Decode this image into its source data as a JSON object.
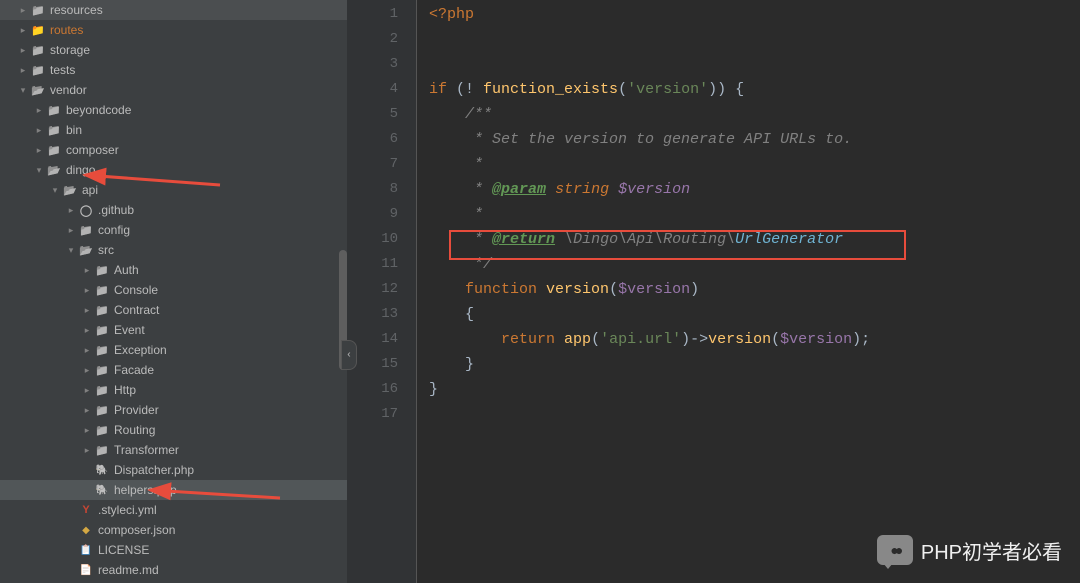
{
  "sidebar": {
    "items": [
      {
        "indent": 1,
        "chev": "closed",
        "icon": "folder",
        "label": "resources"
      },
      {
        "indent": 1,
        "chev": "closed",
        "icon": "folder-orange",
        "label": "routes",
        "orange": true
      },
      {
        "indent": 1,
        "chev": "closed",
        "icon": "folder",
        "label": "storage"
      },
      {
        "indent": 1,
        "chev": "closed",
        "icon": "folder",
        "label": "tests"
      },
      {
        "indent": 1,
        "chev": "open",
        "icon": "folder-open",
        "label": "vendor"
      },
      {
        "indent": 2,
        "chev": "closed",
        "icon": "folder",
        "label": "beyondcode"
      },
      {
        "indent": 2,
        "chev": "closed",
        "icon": "folder",
        "label": "bin"
      },
      {
        "indent": 2,
        "chev": "closed",
        "icon": "folder",
        "label": "composer"
      },
      {
        "indent": 2,
        "chev": "open",
        "icon": "folder-open",
        "label": "dingo"
      },
      {
        "indent": 3,
        "chev": "open",
        "icon": "folder-open",
        "label": "api"
      },
      {
        "indent": 4,
        "chev": "closed",
        "icon": "github",
        "label": ".github"
      },
      {
        "indent": 4,
        "chev": "closed",
        "icon": "folder",
        "label": "config"
      },
      {
        "indent": 4,
        "chev": "open",
        "icon": "folder-open",
        "label": "src"
      },
      {
        "indent": 5,
        "chev": "closed",
        "icon": "folder",
        "label": "Auth"
      },
      {
        "indent": 5,
        "chev": "closed",
        "icon": "folder",
        "label": "Console"
      },
      {
        "indent": 5,
        "chev": "closed",
        "icon": "folder",
        "label": "Contract"
      },
      {
        "indent": 5,
        "chev": "closed",
        "icon": "folder",
        "label": "Event"
      },
      {
        "indent": 5,
        "chev": "closed",
        "icon": "folder",
        "label": "Exception"
      },
      {
        "indent": 5,
        "chev": "closed",
        "icon": "folder",
        "label": "Facade"
      },
      {
        "indent": 5,
        "chev": "closed",
        "icon": "folder",
        "label": "Http"
      },
      {
        "indent": 5,
        "chev": "closed",
        "icon": "folder",
        "label": "Provider"
      },
      {
        "indent": 5,
        "chev": "closed",
        "icon": "folder",
        "label": "Routing"
      },
      {
        "indent": 5,
        "chev": "closed",
        "icon": "folder",
        "label": "Transformer"
      },
      {
        "indent": 5,
        "chev": "none",
        "icon": "php",
        "label": "Dispatcher.php"
      },
      {
        "indent": 5,
        "chev": "none",
        "icon": "php",
        "label": "helpers.php",
        "selected": true
      },
      {
        "indent": 4,
        "chev": "none",
        "icon": "yml",
        "label": ".styleci.yml"
      },
      {
        "indent": 4,
        "chev": "none",
        "icon": "json",
        "label": "composer.json"
      },
      {
        "indent": 4,
        "chev": "none",
        "icon": "license",
        "label": "LICENSE"
      },
      {
        "indent": 4,
        "chev": "none",
        "icon": "md",
        "label": "readme.md"
      }
    ]
  },
  "code": {
    "lines": [
      {
        "n": "1",
        "html": "<span class='kw'>&lt;?php</span>"
      },
      {
        "n": "2",
        "html": ""
      },
      {
        "n": "3",
        "html": ""
      },
      {
        "n": "4",
        "html": "<span class='kw'>if</span> (! <span class='fn2'>function_exists</span>(<span class='str'>'version'</span>)) {"
      },
      {
        "n": "5",
        "html": "    <span class='cmt'>/**</span>"
      },
      {
        "n": "6",
        "html": "    <span class='cmt'> * Set the version to generate API URLs to.</span>"
      },
      {
        "n": "7",
        "html": "    <span class='cmt'> *</span>"
      },
      {
        "n": "8",
        "html": "    <span class='cmt'> * <span class='tag'>@param</span> <span class='kw'>string</span> <span class='var'>$version</span></span>"
      },
      {
        "n": "9",
        "html": "    <span class='cmt'> *</span>"
      },
      {
        "n": "10",
        "html": "    <span class='cmt'> * <span class='tag'>@return</span> <span class='ns'>\\Dingo\\Api\\Routing\\</span><span class='cls'>UrlGenerator</span></span>"
      },
      {
        "n": "11",
        "html": "    <span class='cmt'> */</span>"
      },
      {
        "n": "12",
        "html": "    <span class='kw'>function</span> <span class='fn2'>version</span>(<span class='var'>$version</span>)"
      },
      {
        "n": "13",
        "html": "    {"
      },
      {
        "n": "14",
        "html": "        <span class='kw'>return</span> <span class='fn2'>app</span>(<span class='str'>'api.url'</span>)-&gt;<span class='fn2'>version</span>(<span class='var'>$version</span>);"
      },
      {
        "n": "15",
        "html": "    }"
      },
      {
        "n": "16",
        "html": "}"
      },
      {
        "n": "17",
        "html": ""
      }
    ]
  },
  "watermark": {
    "text": "PHP初学者必看"
  },
  "collapse_handle": "‹"
}
